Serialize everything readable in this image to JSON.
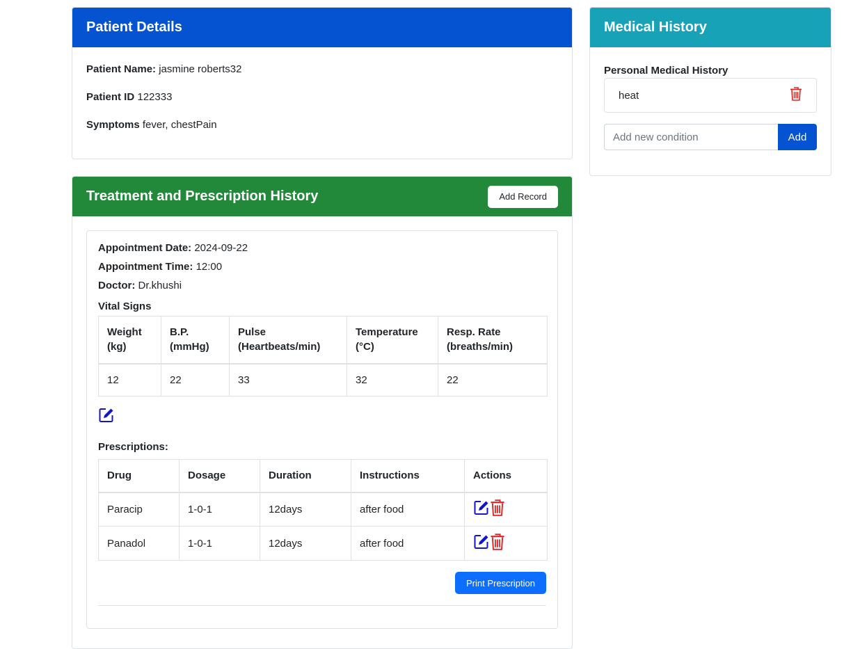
{
  "patient": {
    "header": "Patient Details",
    "name_label": "Patient Name:",
    "name_value": "jasmine roberts32",
    "id_label": "Patient ID",
    "id_value": "122333",
    "symptoms_label": "Symptoms",
    "symptoms_value": "fever, chestPain"
  },
  "treatment": {
    "header": "Treatment and Prescription History",
    "add_record_label": "Add Record",
    "appointment_date_label": "Appointment Date:",
    "appointment_date_value": "2024-09-22",
    "appointment_time_label": "Appointment Time:",
    "appointment_time_value": "12:00",
    "doctor_label": "Doctor:",
    "doctor_value": "Dr.khushi",
    "vitals_heading": "Vital Signs",
    "vitals_headers": [
      [
        "Weight",
        "(kg)"
      ],
      [
        "B.P.",
        "(mmHg)"
      ],
      [
        "Pulse",
        "(Heartbeats/min)"
      ],
      [
        "Temperature",
        "(°C)"
      ],
      [
        "Resp. Rate",
        "(breaths/min)"
      ]
    ],
    "vitals_values": [
      "12",
      "22",
      "33",
      "32",
      "22"
    ],
    "prescriptions_heading": "Prescriptions:",
    "prescription_headers": [
      "Drug",
      "Dosage",
      "Duration",
      "Instructions",
      "Actions"
    ],
    "prescriptions": [
      {
        "drug": "Paracip",
        "dosage": "1-0-1",
        "duration": "12days",
        "instructions": "after food"
      },
      {
        "drug": "Panadol",
        "dosage": "1-0-1",
        "duration": "12days",
        "instructions": "after food"
      }
    ],
    "print_label": "Print Prescription"
  },
  "history": {
    "header": "Medical History",
    "personal_label": "Personal Medical History",
    "items": [
      "heat"
    ],
    "new_condition_placeholder": "Add new condition",
    "add_label": "Add"
  },
  "colors": {
    "primary": "#0553d1",
    "success": "#22883a",
    "info": "#17a2b8",
    "edit_icon": "#1414c8",
    "delete_icon": "#dc2626"
  }
}
